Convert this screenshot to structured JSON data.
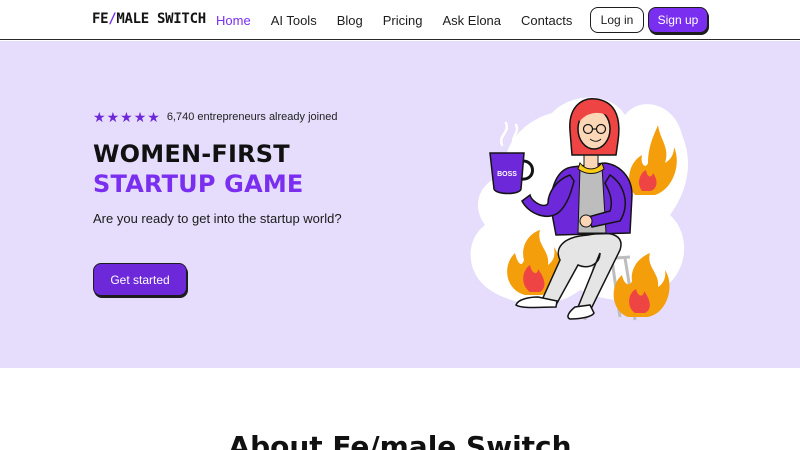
{
  "header": {
    "logo_pre": "FE",
    "logo_slash": "/",
    "logo_post": "MALE SWITCH",
    "nav": [
      "Home",
      "AI Tools",
      "Blog",
      "Pricing",
      "Ask Elona",
      "Contacts"
    ],
    "login_label": "Log in",
    "signup_label": "Sign up"
  },
  "hero": {
    "stars": "★★★★★",
    "rating_text": "6,740 entrepreneurs already joined",
    "headline_line1": "WOMEN-FIRST",
    "headline_line2": "STARTUP GAME",
    "subtitle": "Are you ready to get into the startup world?",
    "cta_label": "Get started",
    "mug_text": "BOSS"
  },
  "about": {
    "title": "About Fe/male Switch"
  },
  "colors": {
    "accent": "#7a2ff0",
    "hero_bg": "#e6dcfb",
    "flame": "#f59e0b"
  }
}
